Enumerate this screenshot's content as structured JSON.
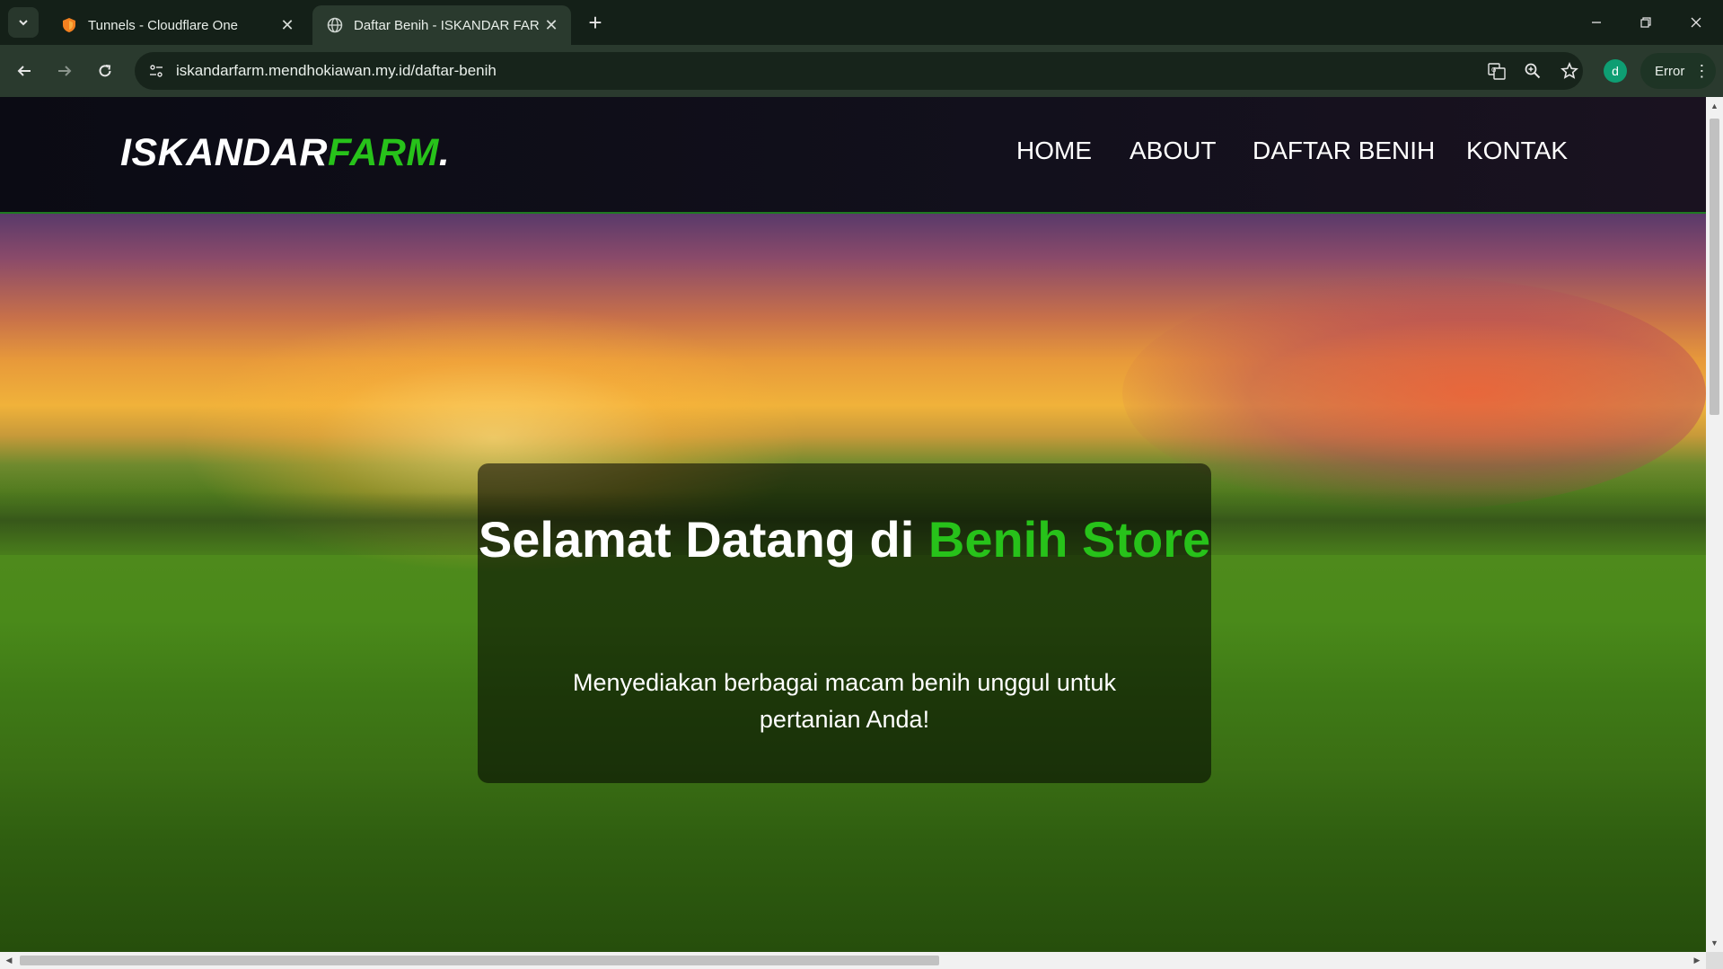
{
  "browser": {
    "tabs": [
      {
        "title": "Tunnels - Cloudflare One",
        "favicon": "cloudflare-shield-icon",
        "active": false
      },
      {
        "title": "Daftar Benih - ISKANDAR FARM",
        "favicon": "globe-icon",
        "active": true
      }
    ],
    "new_tab_symbol": "+",
    "url": "iskandarfarm.mendhokiawan.my.id/daftar-benih",
    "profile_initial": "d",
    "error_label": "Error",
    "colors": {
      "frame": "#142018",
      "toolbar": "#2a3a2e",
      "profile": "#0e9e73"
    }
  },
  "site": {
    "logo": {
      "part1": "ISKANDAR",
      "part2": "FARM",
      "dot": "."
    },
    "nav": [
      "HOME",
      "ABOUT",
      "DAFTAR BENIH",
      "KONTAK"
    ],
    "hero": {
      "title_part1": "Selamat Datang di ",
      "title_part2": "Benih Store",
      "subtitle": "Menyediakan berbagai macam benih unggul untuk pertanian Anda!"
    },
    "colors": {
      "accent": "#27c21a",
      "header_bg": "#0b0b14",
      "text": "#ffffff"
    }
  }
}
